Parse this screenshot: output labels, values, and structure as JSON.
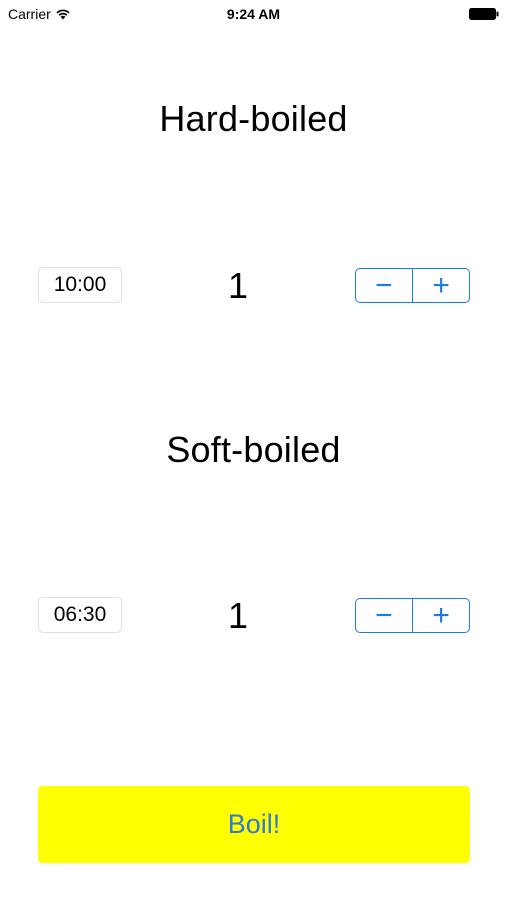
{
  "status_bar": {
    "carrier": "Carrier",
    "time": "9:24 AM"
  },
  "sections": [
    {
      "title": "Hard-boiled",
      "timer": "10:00",
      "count": "1",
      "stepper": {
        "minus": "−",
        "plus": "+"
      }
    },
    {
      "title": "Soft-boiled",
      "timer": "06:30",
      "count": "1",
      "stepper": {
        "minus": "−",
        "plus": "+"
      }
    }
  ],
  "boil_button": {
    "label": "Boil!",
    "background": "#ffff00",
    "text_color": "#2e7bd3"
  },
  "colors": {
    "accent": "#1d7ae0"
  }
}
